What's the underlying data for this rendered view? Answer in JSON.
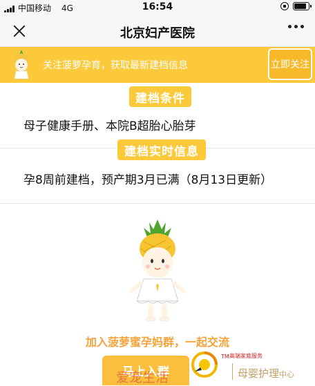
{
  "status_bar": {
    "carrier": "中国移动",
    "network": "4G",
    "time": "16:54"
  },
  "nav": {
    "title": "北京妇产医院"
  },
  "banner": {
    "text": "关注菠萝孕育，获取最新建档信息",
    "follow_label": "立即关注"
  },
  "sections": [
    {
      "heading": "建档条件",
      "content": "母子健康手册、本院B超胎心胎芽"
    },
    {
      "heading": "建档实时信息",
      "content": "孕8周前建档，预产期3月已满（8月13日更新）"
    }
  ],
  "community": {
    "invite_text": "加入菠萝蜜孕妈群，一起交流",
    "join_label": "马上入群",
    "watermark": "爱宠生活"
  },
  "brand": {
    "tm": "TM",
    "tm_text": "高端家庭服务",
    "service_name": "母婴护理",
    "service_suffix": "中心"
  },
  "colors": {
    "accent": "#fcc93a",
    "accent_text": "#f5a23a",
    "nav_bg": "#f7f7f7"
  }
}
